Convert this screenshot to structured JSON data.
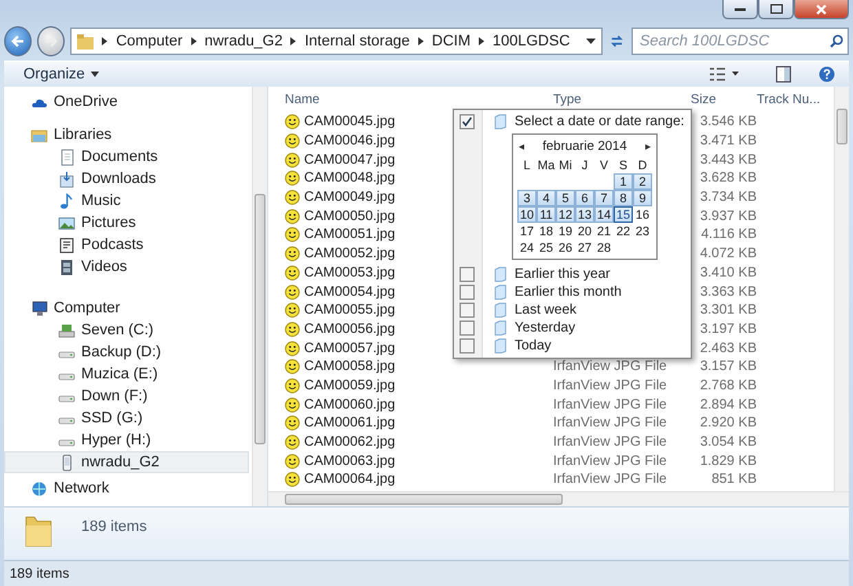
{
  "address": {
    "crumbs": [
      "Computer",
      "nwradu_G2",
      "Internal storage",
      "DCIM",
      "100LGDSC"
    ],
    "search_placeholder": "Search 100LGDSC"
  },
  "toolbar": {
    "organize": "Organize"
  },
  "nav": [
    {
      "label": "OneDrive",
      "kind": "cloud",
      "selected": false
    },
    {
      "label": "Libraries",
      "kind": "library",
      "selected": false,
      "children": [
        {
          "label": "Documents",
          "kind": "document",
          "selected": false
        },
        {
          "label": "Downloads",
          "kind": "download",
          "selected": false
        },
        {
          "label": "Music",
          "kind": "music",
          "selected": false
        },
        {
          "label": "Pictures",
          "kind": "picture",
          "selected": false
        },
        {
          "label": "Podcasts",
          "kind": "podcast",
          "selected": false
        },
        {
          "label": "Videos",
          "kind": "video",
          "selected": false
        }
      ]
    },
    {
      "label": "Computer",
      "kind": "computer",
      "selected": false,
      "children": [
        {
          "label": "Seven (C:)",
          "kind": "system-drive",
          "selected": false
        },
        {
          "label": "Backup (D:)",
          "kind": "drive",
          "selected": false
        },
        {
          "label": "Muzica (E:)",
          "kind": "drive",
          "selected": false
        },
        {
          "label": "Down (F:)",
          "kind": "drive",
          "selected": false
        },
        {
          "label": "SSD (G:)",
          "kind": "drive",
          "selected": false
        },
        {
          "label": "Hyper (H:)",
          "kind": "drive",
          "selected": false
        },
        {
          "label": "nwradu_G2",
          "kind": "phone",
          "selected": true
        }
      ]
    },
    {
      "label": "Network",
      "kind": "network",
      "selected": false
    }
  ],
  "columns": [
    "Name",
    "Type",
    "Size",
    "Track Nu..."
  ],
  "files": [
    {
      "name": "CAM00045.jpg",
      "size": "3.546 KB"
    },
    {
      "name": "CAM00046.jpg",
      "size": "3.471 KB"
    },
    {
      "name": "CAM00047.jpg",
      "size": "3.443 KB"
    },
    {
      "name": "CAM00048.jpg",
      "size": "3.628 KB"
    },
    {
      "name": "CAM00049.jpg",
      "size": "3.734 KB"
    },
    {
      "name": "CAM00050.jpg",
      "size": "3.937 KB"
    },
    {
      "name": "CAM00051.jpg",
      "size": "4.116 KB"
    },
    {
      "name": "CAM00052.jpg",
      "size": "4.072 KB"
    },
    {
      "name": "CAM00053.jpg",
      "size": "3.410 KB"
    },
    {
      "name": "CAM00054.jpg",
      "size": "3.363 KB"
    },
    {
      "name": "CAM00055.jpg",
      "size": "3.301 KB"
    },
    {
      "name": "CAM00056.jpg",
      "size": "3.197 KB"
    },
    {
      "name": "CAM00057.jpg",
      "size": "2.463 KB"
    },
    {
      "name": "CAM00058.jpg",
      "type": "IrfanView JPG File",
      "size": "3.157 KB"
    },
    {
      "name": "CAM00059.jpg",
      "type": "IrfanView JPG File",
      "size": "2.768 KB"
    },
    {
      "name": "CAM00060.jpg",
      "type": "IrfanView JPG File",
      "size": "2.894 KB"
    },
    {
      "name": "CAM00061.jpg",
      "type": "IrfanView JPG File",
      "size": "2.920 KB"
    },
    {
      "name": "CAM00062.jpg",
      "type": "IrfanView JPG File",
      "size": "3.054 KB"
    },
    {
      "name": "CAM00063.jpg",
      "type": "IrfanView JPG File",
      "size": "1.829 KB"
    },
    {
      "name": "CAM00064.jpg",
      "type": "IrfanView JPG File",
      "size": "851 KB"
    }
  ],
  "filter_popup": {
    "options": [
      {
        "label": "Select a date or date range:",
        "checked": true,
        "kind": "range"
      },
      {
        "label": "Earlier this year",
        "checked": false,
        "kind": "preset"
      },
      {
        "label": "Earlier this month",
        "checked": false,
        "kind": "preset"
      },
      {
        "label": "Last week",
        "checked": false,
        "kind": "preset"
      },
      {
        "label": "Yesterday",
        "checked": false,
        "kind": "preset"
      },
      {
        "label": "Today",
        "checked": false,
        "kind": "preset"
      }
    ],
    "calendar": {
      "prev": "◂",
      "month": "februarie 2014",
      "next": "▸",
      "weekdays": [
        "L",
        "Ma",
        "Mi",
        "J",
        "V",
        "S",
        "D"
      ],
      "weeks": [
        {
          "days": [
            {
              "day": "1",
              "selected": true,
              "today": false
            },
            {
              "day": "2",
              "selected": true,
              "today": false
            }
          ]
        },
        {
          "days": [
            {
              "day": "3",
              "selected": true,
              "today": false
            },
            {
              "day": "4",
              "selected": true,
              "today": false
            },
            {
              "day": "5",
              "selected": true,
              "today": false
            },
            {
              "day": "6",
              "selected": true,
              "today": false
            },
            {
              "day": "7",
              "selected": true,
              "today": false
            },
            {
              "day": "8",
              "selected": true,
              "today": false
            },
            {
              "day": "9",
              "selected": true,
              "today": false
            }
          ]
        },
        {
          "days": [
            {
              "day": "10",
              "selected": true,
              "today": false
            },
            {
              "day": "11",
              "selected": true,
              "today": false
            },
            {
              "day": "12",
              "selected": true,
              "today": false
            },
            {
              "day": "13",
              "selected": true,
              "today": false
            },
            {
              "day": "14",
              "selected": true,
              "today": false
            },
            {
              "day": "15",
              "selected": true,
              "today": true
            },
            {
              "day": "16",
              "selected": false,
              "today": false
            }
          ]
        },
        {
          "days": [
            {
              "day": "17",
              "selected": false,
              "today": false
            },
            {
              "day": "18",
              "selected": false,
              "today": false
            },
            {
              "day": "19",
              "selected": false,
              "today": false
            },
            {
              "day": "20",
              "selected": false,
              "today": false
            },
            {
              "day": "21",
              "selected": false,
              "today": false
            },
            {
              "day": "22",
              "selected": false,
              "today": false
            },
            {
              "day": "23",
              "selected": false,
              "today": false
            }
          ]
        },
        {
          "days": [
            {
              "day": "24",
              "selected": false,
              "today": false
            },
            {
              "day": "25",
              "selected": false,
              "today": false
            },
            {
              "day": "26",
              "selected": false,
              "today": false
            },
            {
              "day": "27",
              "selected": false,
              "today": false
            },
            {
              "day": "28",
              "selected": false,
              "today": false
            }
          ]
        }
      ]
    }
  },
  "details": {
    "count": "189 items"
  },
  "status": "189 items"
}
